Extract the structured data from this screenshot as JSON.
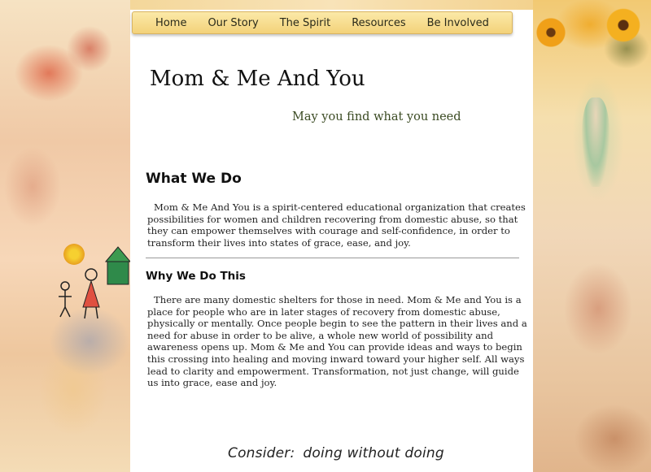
{
  "nav": {
    "items": [
      "Home",
      "Our Story",
      "The Spirit",
      "Resources",
      "Be Involved"
    ]
  },
  "site": {
    "title": "Mom & Me And You",
    "tagline": "May you find what you need"
  },
  "what_we_do": {
    "heading": "What We Do",
    "body": "Mom & Me And You is a spirit-centered educational organization that creates possibilities for women and children recovering from domestic abuse, so that they can empower themselves with courage and self-confidence, in order to transform their lives into states of grace, ease, and joy."
  },
  "why_we_do_this": {
    "heading": "Why We Do This",
    "body": "There are many domestic shelters for those in need. Mom & Me and You is a place for people who are in later stages of recovery from domestic abuse, physically or mentally. Once people begin to see the pattern in their lives and a need for abuse in order to be alive, a whole new world of possibility and awareness opens up. Mom & Me and You can provide ideas and ways to begin this crossing into healing and moving inward toward your higher self. All ways lead to clarity and empowerment. Transformation, not just change, will guide us into grace, ease and joy."
  },
  "footer": {
    "quote_label": "Consider:",
    "quote_text": "doing without doing"
  },
  "colors": {
    "nav_bar": "#f3d27a",
    "tagline": "#3a4a22",
    "content_bg": "#ffffff"
  }
}
